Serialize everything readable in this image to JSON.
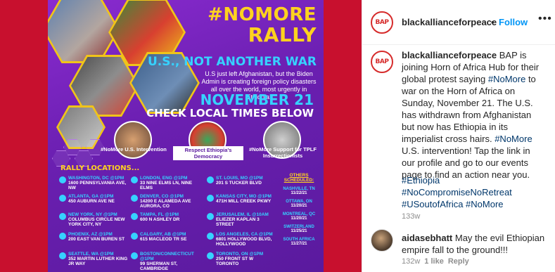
{
  "post": {
    "headline_line1": "#NOMORE",
    "headline_line2": "RALLY",
    "subhead": "U.S., NOT ANOTHER WAR",
    "blurb": "U.S just left Afghanistan, but the Biden Admin is creating foreign policy disasters all over the world, most urgently in Ethiopia!",
    "date_big": "NOVEMBER 21",
    "check_times": "CHECK LOCAL TIMES BELOW",
    "captions": [
      "#NoMore U.S. Intervention",
      "Respect Ethiopia's Democracy",
      "#NoMore Support for TPLF Insurrectionists"
    ],
    "rally_title": "RALLY LOCATIONS...",
    "locations": [
      {
        "city": "WASHINGTON, DC @1PM",
        "addr": "1600 PENNSYLVANIA AVE, NW"
      },
      {
        "city": "ATLANTA, GA @1PM",
        "addr": "450 AUBURN AVE NE"
      },
      {
        "city": "NEW YORK, NY @1PM",
        "addr": "COLUMBUS CIRCLE NEW YORK CITY, NY"
      },
      {
        "city": "PHOENIX, AZ @1PM",
        "addr": "200 EAST VAN BUREN ST"
      },
      {
        "city": "SEATTLE, WA @1PM",
        "addr": "352 MARTIN LUTHER KING JR WAY"
      },
      {
        "city": "LONDON, ENG @1PM",
        "addr": "33 NINE ELMS LN, NINE ELMS"
      },
      {
        "city": "DENVER, CO @1PM",
        "addr": "14200 E ALAMEDA AVE AURORA, CO"
      },
      {
        "city": "TAMPA, FL @1PM",
        "addr": "600 N ASHLEY DR"
      },
      {
        "city": "CALGARY, AB @1PM",
        "addr": "615 MACLEOD TR SE"
      },
      {
        "city": "BOSTON/CONNECTICUT @1PM",
        "addr": "99 SHERMAN ST, CAMBRIDGE"
      },
      {
        "city": "ST. LOUIS, MO @1PM",
        "addr": "201 S TUCKER BLVD"
      },
      {
        "city": "KANSAS CITY, MO @1PM",
        "addr": "471H MILL CREEK PKWY"
      },
      {
        "city": "JERUSALEM, IL @10AM",
        "addr": "ELIEZER KAPLAN 3 STREET"
      },
      {
        "city": "LOS ANGELES, CA @1PM",
        "addr": "6801 HOLLYWOOD BLVD, HOLLYWOOD"
      },
      {
        "city": "TORONTO, ON @1PM",
        "addr": "250 FRONT ST W TORONTO"
      }
    ],
    "others_title": "OTHERS SCHEDULED:",
    "others": [
      {
        "city": "NASHVILLE, TN",
        "date": "11/22/21"
      },
      {
        "city": "OTTAWA, ON",
        "date": "11/20/21"
      },
      {
        "city": "MONTREAL, QC",
        "date": "11/20/21"
      },
      {
        "city": "SWITZERLAND",
        "date": "11/25/21"
      },
      {
        "city": "SOUTH AFRICA",
        "date": "11/27/21"
      }
    ]
  },
  "header": {
    "avatar_text": "BAP",
    "username": "blackallianceforpeace",
    "separator": "•",
    "follow_label": "Follow",
    "more_label": "•••"
  },
  "caption": {
    "username": "blackallianceforpeace",
    "text_before": " BAP is joining Horn of Africa Hub for their global protest saying ",
    "tag1": "#NoMore",
    "text_mid": " to war on the Horn of Africa on Sunday, November 21. The U.S. has withdrawn from Afghanistan but now has Ethiopia in its imperialist cross hairs. ",
    "tag2": "#NoMore",
    "text_after": " U.S. intervention! Tap the link in our profile and go to our events page to find an action near you.",
    "hashtags": [
      "#Ethiopia",
      "#NoCompromiseNoRetreat",
      "#USoutofAfrica #NoMore"
    ],
    "time": "133w"
  },
  "comment": {
    "username": "aidasebhatt",
    "text": " May the evil Ethiopian empire fall to the ground!!!",
    "time": "132w",
    "likes": "1 like",
    "reply": "Reply"
  },
  "colors": {
    "poster_bg": "#6a1fb0",
    "frame_red": "#c8102e",
    "yellow": "#ffd21f",
    "cyan": "#36d2ff",
    "link_blue": "#0095f6",
    "hashtag_blue": "#00376b"
  }
}
